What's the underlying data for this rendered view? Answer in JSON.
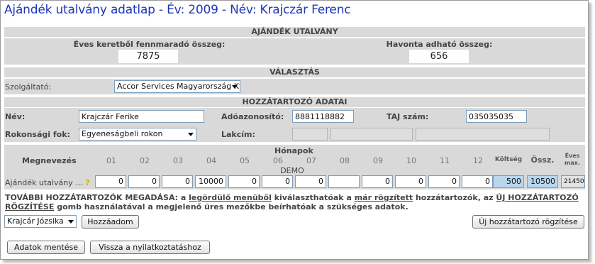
{
  "title": "Ajándék utalvány adatlap - Év: 2009 - Név: Krajczár Ferenc",
  "voucher": {
    "heading": "AJÁNDÉK UTALVÁNY",
    "yearly_label": "Éves keretből fennmaradó összeg:",
    "yearly_value": "7875",
    "monthly_label": "Havonta adható összeg:",
    "monthly_value": "656"
  },
  "choice": {
    "heading": "VÁLASZTÁS",
    "provider_label": "Szolgáltató:",
    "provider_value": "Accor Services Magyarország Kft."
  },
  "relative": {
    "heading": "HOZZÁTARTOZÓ ADATAI",
    "name_label": "Név:",
    "name_value": "Krajczár Ferike",
    "tax_label": "Adóazonosító:",
    "tax_value": "8881118882",
    "taj_label": "TAJ szám:",
    "taj_value": "035035035",
    "relation_label": "Rokonsági fok:",
    "relation_value": "Egyeneságbeli rokon",
    "address_label": "Lakcím:"
  },
  "grid": {
    "name_header": "Megnevezés",
    "months_header": "Hónapok",
    "months": [
      "01",
      "02",
      "03",
      "04",
      "05",
      "06",
      "07",
      "08",
      "09",
      "10",
      "11",
      "12"
    ],
    "demo": "DEMO",
    "cost_header": "Költség",
    "sum_header": "Össz.",
    "max_header_1": "Éves",
    "max_header_2": "max.",
    "row_label": "Ajándék utalvány ...",
    "help_icon": "?",
    "values": [
      "0",
      "0",
      "0",
      "10000",
      "0",
      "0",
      "0",
      "",
      "0",
      "0",
      "0",
      "0"
    ],
    "cost": "500",
    "sum": "10500",
    "max": "21450"
  },
  "info": {
    "p1": "TOVÁBBI HOZZÁTARTOZÓK MEGADÁSA: a ",
    "link1": "legördülő menüből",
    "p2": " kiválaszthatóak a ",
    "link2": "már rögzített",
    "p3": " hozzátartozók, az ",
    "link3": "ÚJ HOZZÁTARTOZÓ",
    "link4": "RÖGZÍTÉSE",
    "p4": " gomb használatával a megjelenő üres mezőkbe beírhatóak a szükséges adatok."
  },
  "controls": {
    "relative_select": "Krajcár Józsika",
    "add_button": "Hozzáadom",
    "new_relative_button": "Új hozzátartozó rögzítése",
    "save_button": "Adatok mentése",
    "back_button": "Vissza a nyilatkoztatáshoz"
  }
}
